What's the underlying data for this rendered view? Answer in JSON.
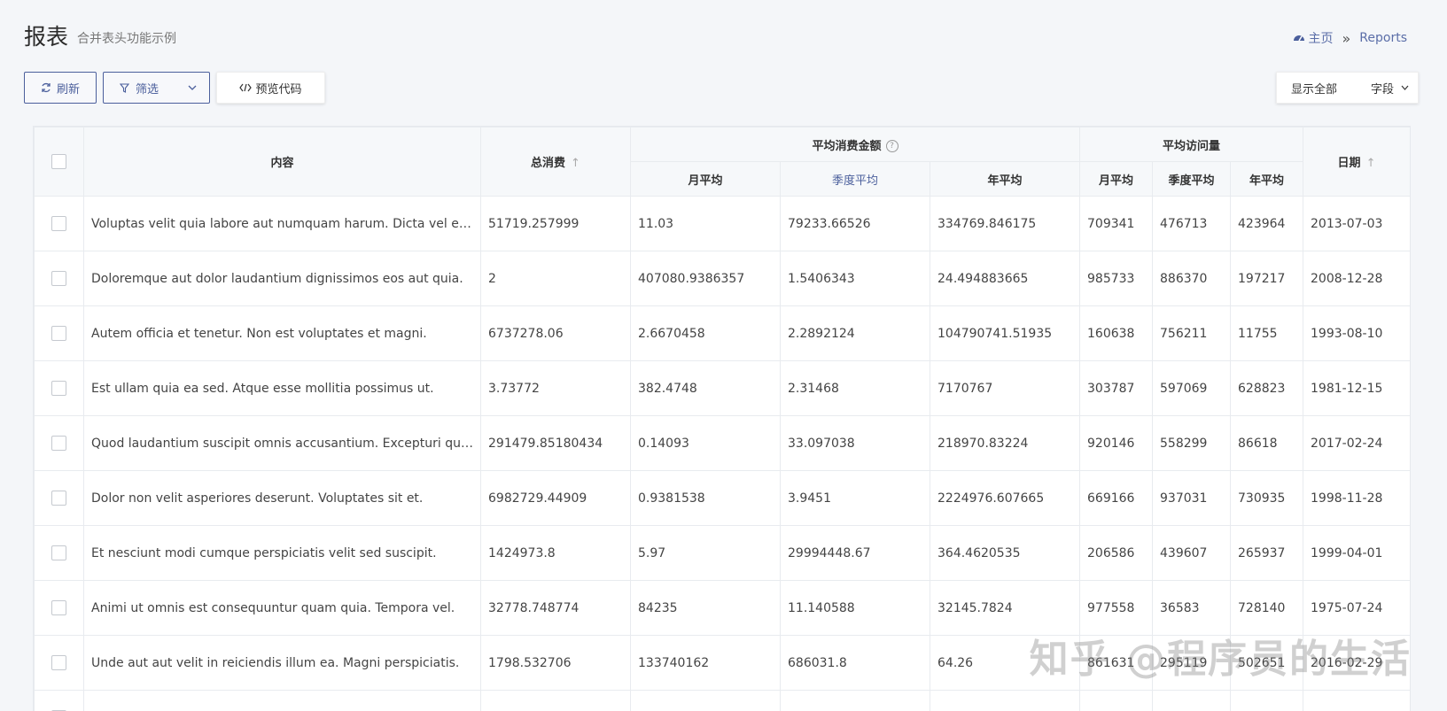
{
  "header": {
    "title": "报表",
    "subtitle": "合并表头功能示例"
  },
  "breadcrumb": {
    "home": "主页",
    "separator": "»",
    "current": "Reports"
  },
  "toolbar": {
    "refresh": "刷新",
    "filter": "筛选",
    "preview_code": "预览代码"
  },
  "right_tools": {
    "show_all": "显示全部",
    "fields": "字段"
  },
  "table": {
    "headers": {
      "content": "内容",
      "total": "总消费",
      "avg_amount": "平均消费金额",
      "avg_visits": "平均访问量",
      "date": "日期",
      "amount_sub": [
        "月平均",
        "季度平均",
        "年平均"
      ],
      "visits_sub": [
        "月平均",
        "季度平均",
        "年平均"
      ]
    },
    "rows": [
      [
        "Voluptas velit quia labore aut numquam harum. Dicta vel et quos.",
        "51719.257999",
        "11.03",
        "79233.66526",
        "334769.846175",
        "709341",
        "476713",
        "423964",
        "2013-07-03"
      ],
      [
        "Doloremque aut dolor laudantium dignissimos eos aut quia.",
        "2",
        "407080.9386357",
        "1.5406343",
        "24.494883665",
        "985733",
        "886370",
        "197217",
        "2008-12-28"
      ],
      [
        "Autem officia et tenetur. Non est voluptates et magni.",
        "6737278.06",
        "2.6670458",
        "2.2892124",
        "104790741.51935",
        "160638",
        "756211",
        "11755",
        "1993-08-10"
      ],
      [
        "Est ullam quia ea sed. Atque esse mollitia possimus ut.",
        "3.73772",
        "382.4748",
        "2.31468",
        "7170767",
        "303787",
        "597069",
        "628823",
        "1981-12-15"
      ],
      [
        "Quod laudantium suscipit omnis accusantium. Excepturi quia.",
        "291479.85180434",
        "0.14093",
        "33.097038",
        "218970.83224",
        "920146",
        "558299",
        "86618",
        "2017-02-24"
      ],
      [
        "Dolor non velit asperiores deserunt. Voluptates sit et.",
        "6982729.44909",
        "0.9381538",
        "3.9451",
        "2224976.607665",
        "669166",
        "937031",
        "730935",
        "1998-11-28"
      ],
      [
        "Et nesciunt modi cumque perspiciatis velit sed suscipit.",
        "1424973.8",
        "5.97",
        "29994448.67",
        "364.4620535",
        "206586",
        "439607",
        "265937",
        "1999-04-01"
      ],
      [
        "Animi ut omnis est consequuntur quam quia. Tempora vel.",
        "32778.748774",
        "84235",
        "11.140588",
        "32145.7824",
        "977558",
        "36583",
        "728140",
        "1975-07-24"
      ],
      [
        "Unde aut aut velit in reiciendis illum ea. Magni perspiciatis.",
        "1798.532706",
        "133740162",
        "686031.8",
        "64.26",
        "861631",
        "295119",
        "502651",
        "2016-02-29"
      ],
      [
        "",
        "",
        "",
        "",
        "",
        "",
        "",
        "",
        ""
      ]
    ]
  },
  "watermark": "知乎 @程序员的生活"
}
